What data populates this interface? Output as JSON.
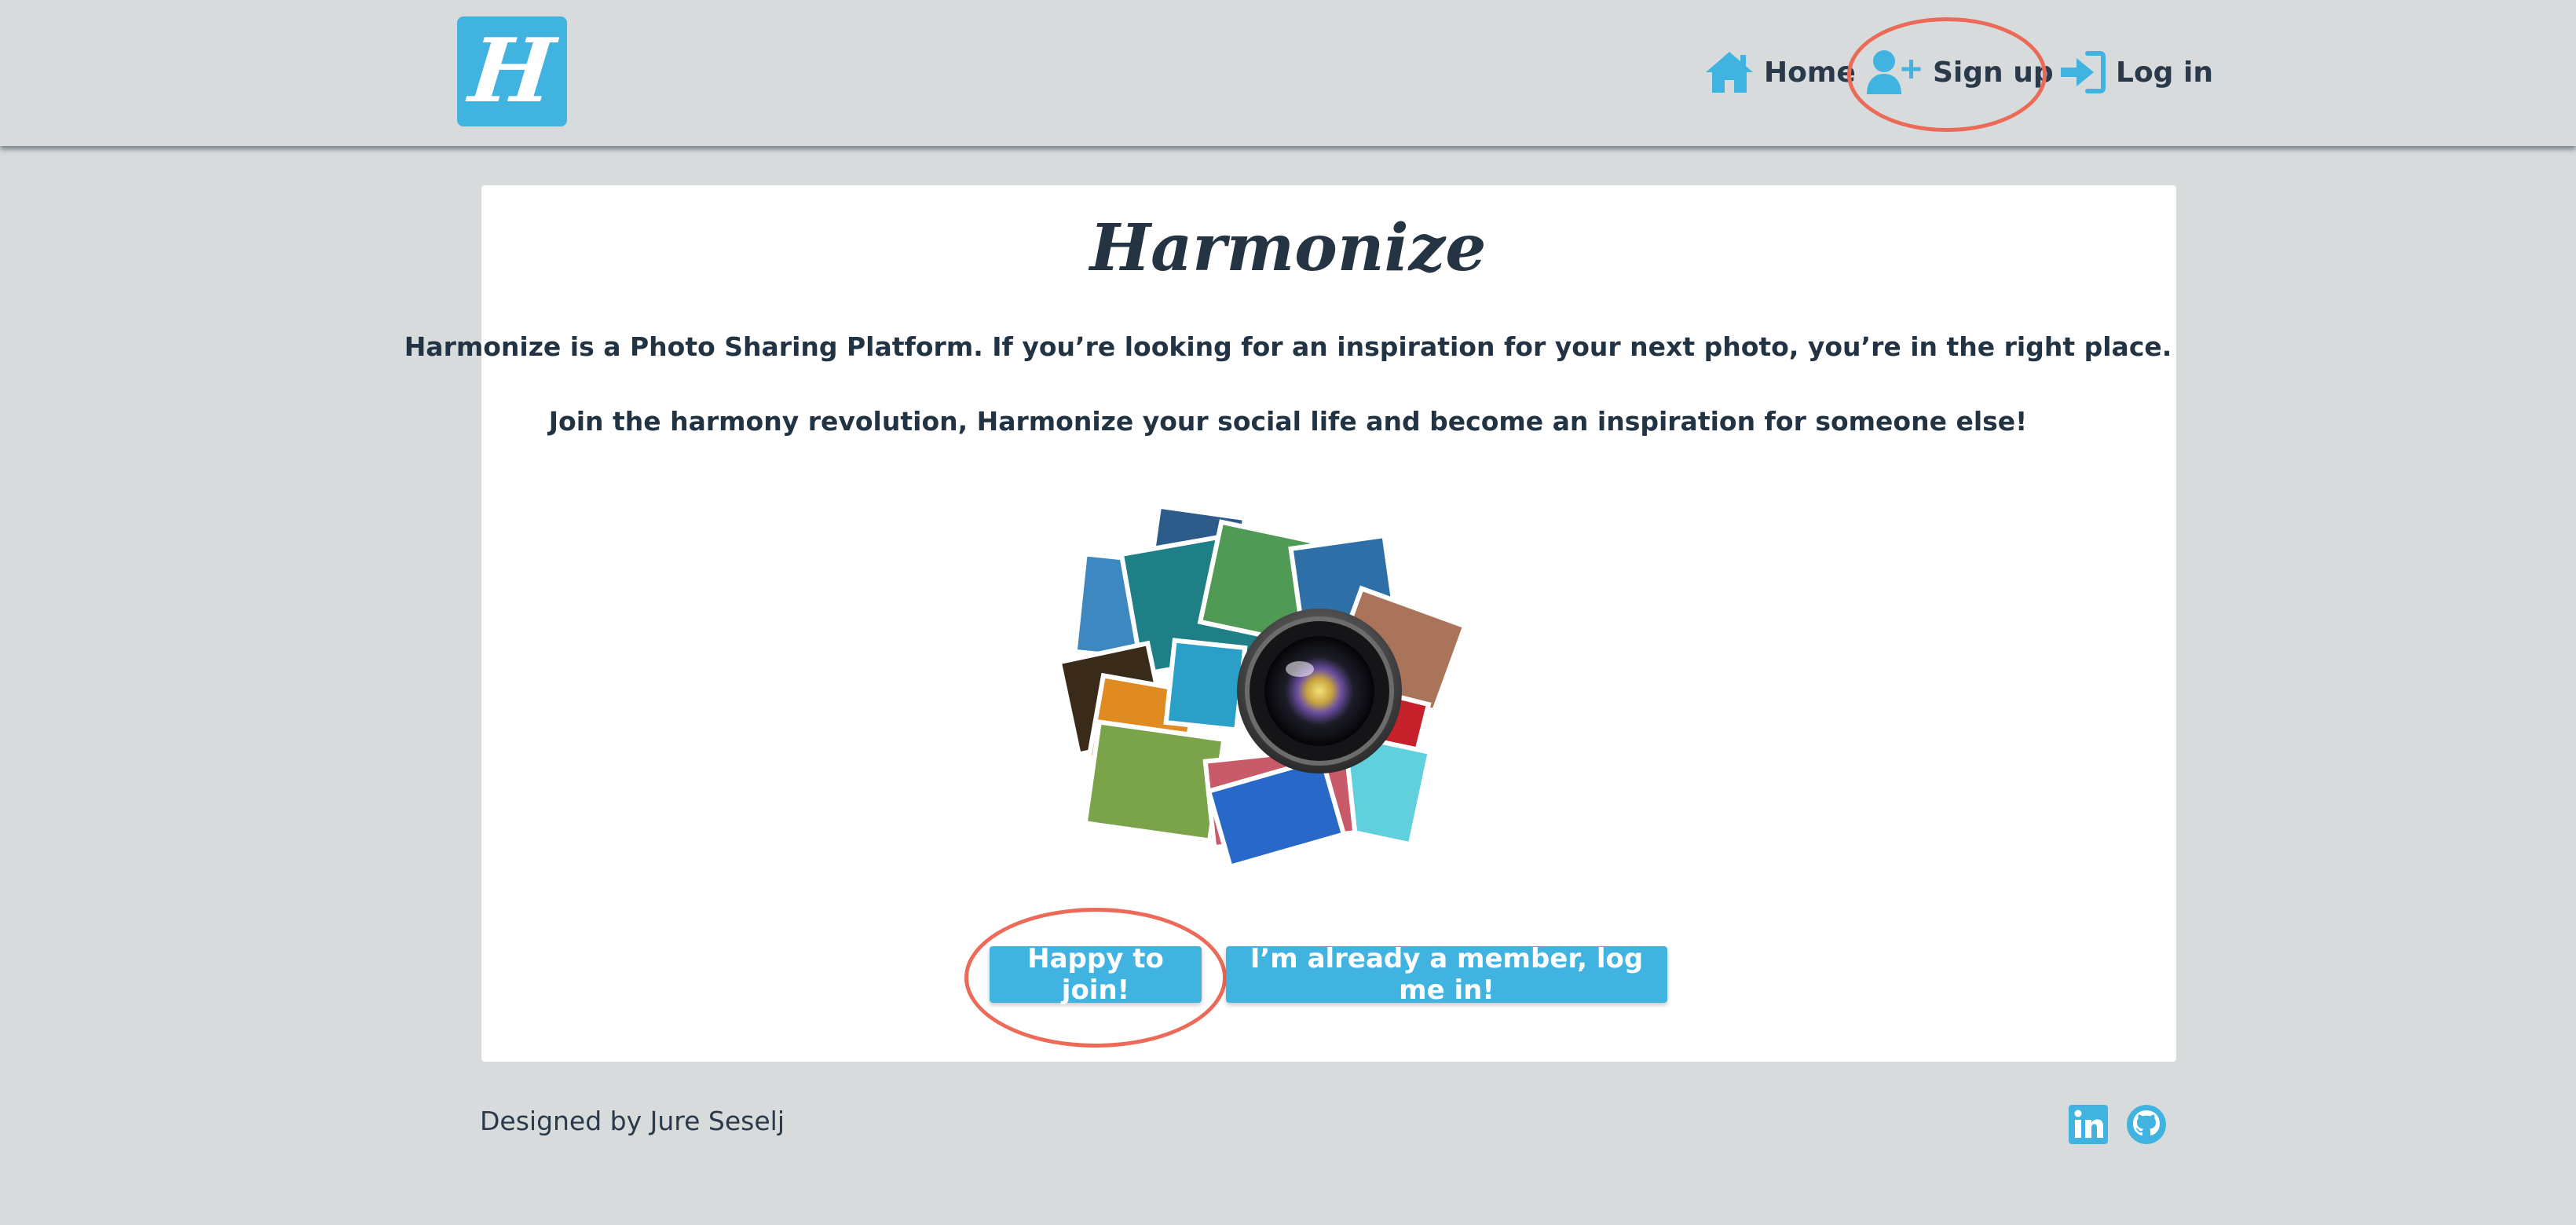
{
  "nav": {
    "logo_letter": "H",
    "home_label": "Home",
    "signup_label": "Sign up",
    "login_label": "Log in"
  },
  "main": {
    "title": "Harmonize",
    "intro_line_1": "Harmonize is a Photo Sharing Platform. If you’re looking for an inspiration for your next photo, you’re in the right place.",
    "intro_line_2": "Join the harmony revolution, Harmonize your social life and become an inspiration for someone else!",
    "hero_image": "photo-collage-with-camera-lens",
    "join_button_label": "Happy to join!",
    "member_button_label": "I’m already a member, log me in!"
  },
  "footer": {
    "credit": "Designed by Jure Seselj",
    "social": [
      "linkedin-icon",
      "github-icon"
    ]
  },
  "colors": {
    "background": "#d7dbdb",
    "accent": "#41b3e0",
    "text": "#223344",
    "highlight": "#ec6a58"
  }
}
